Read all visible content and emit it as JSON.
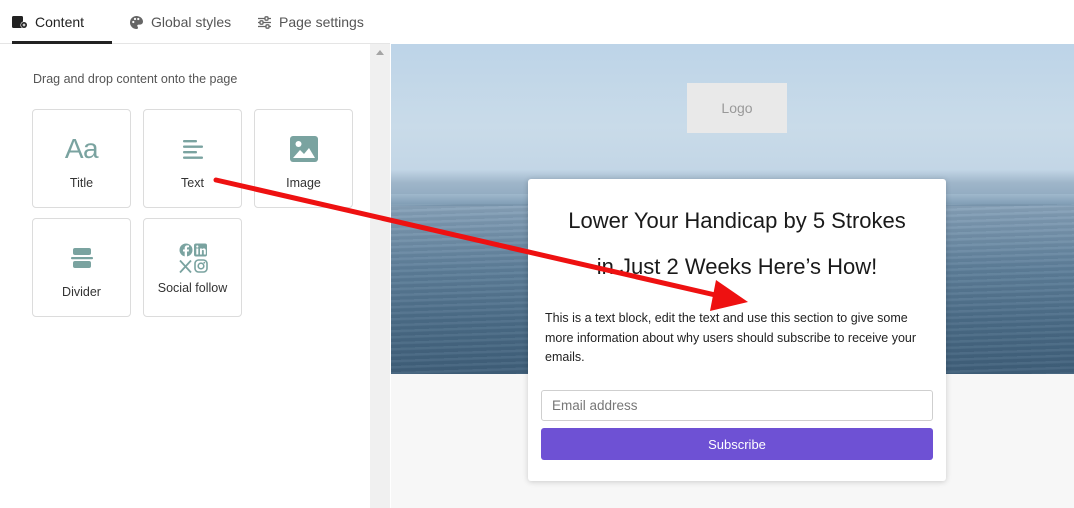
{
  "tabs": [
    {
      "label": "Content",
      "icon": "content-block-icon",
      "active": true
    },
    {
      "label": "Global styles",
      "icon": "palette-icon",
      "active": false
    },
    {
      "label": "Page settings",
      "icon": "sliders-icon",
      "active": false
    }
  ],
  "panel": {
    "hint": "Drag and drop content onto the page",
    "blocks": [
      {
        "label": "Title",
        "icon": "title-icon"
      },
      {
        "label": "Text",
        "icon": "text-icon"
      },
      {
        "label": "Image",
        "icon": "image-icon"
      },
      {
        "label": "Divider",
        "icon": "divider-icon"
      },
      {
        "label": "Social follow",
        "icon": "social-icons"
      }
    ]
  },
  "preview": {
    "logo": "Logo",
    "title_line1": "Lower Your Handicap by 5 Strokes",
    "title_line2": "in Just 2 Weeks Here’s How!",
    "body": "This is a text block, edit the text and use this section to give some more information about why users should subscribe to receive your emails.",
    "email_placeholder": "Email address",
    "subscribe_label": "Subscribe"
  },
  "colors": {
    "accent": "#6e51d4",
    "icon_teal": "#7aa3a0",
    "annotation_arrow": "#ee1111"
  }
}
